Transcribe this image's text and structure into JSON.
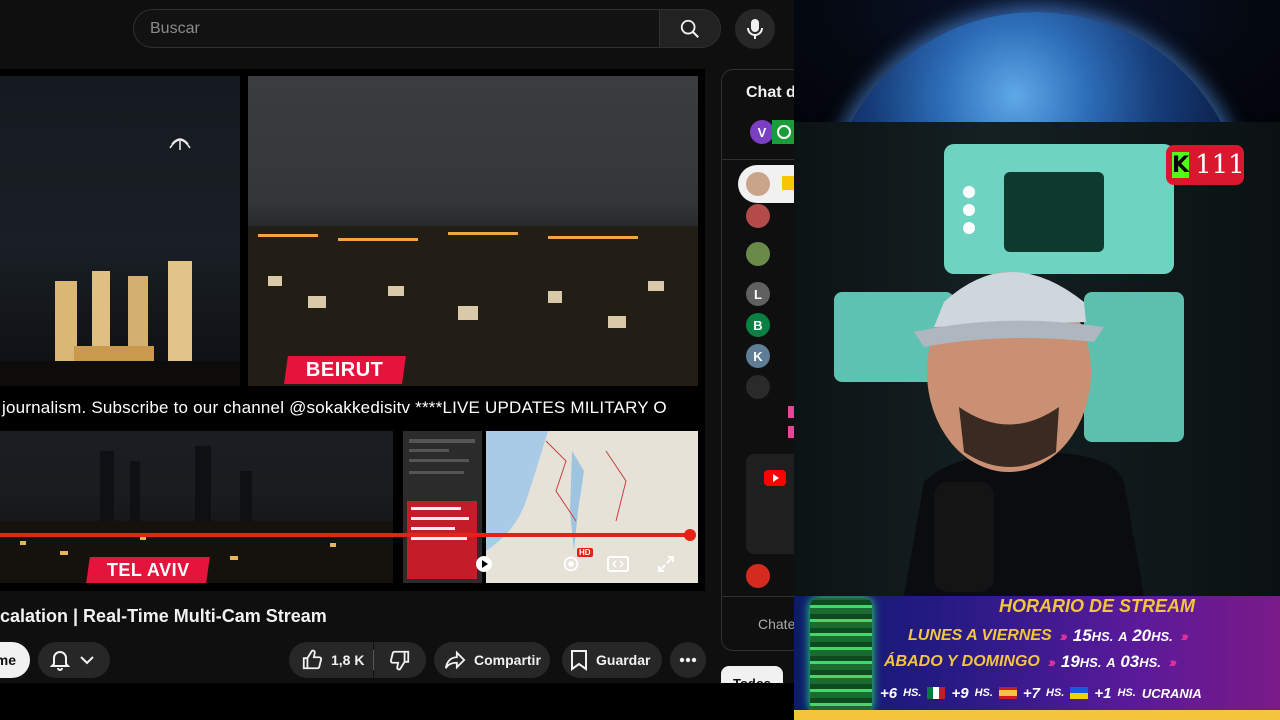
{
  "search": {
    "placeholder": "Buscar"
  },
  "player": {
    "label_beirut": "BEIRUT",
    "label_telaviv": "TEL AVIV",
    "ticker": "journalism. Subscribe to our channel @sokakkedisitv    ****LIVE UPDATES MILITARY O",
    "quality_badge": "HD",
    "progress": 0.99
  },
  "video": {
    "title": "calation | Real-Time Multi-Cam Stream",
    "subscribe_label": "me",
    "like_count": "1,8 K",
    "share_label": "Compartir",
    "save_label": "Guardar"
  },
  "chat": {
    "title": "Chat de",
    "input_placeholder": "Chate",
    "chip_all": "Todos",
    "avatars": [
      {
        "letter": "V",
        "color": "#7b3fc4"
      },
      {
        "letter": "L",
        "color": "#606060"
      },
      {
        "letter": "B",
        "color": "#0b8043"
      },
      {
        "letter": "K",
        "color": "#5f7d95"
      }
    ]
  },
  "overlay": {
    "viewer_count": "111",
    "schedule": {
      "title": "HORARIO DE STREAM",
      "row1_days": "LUNES A VIERNES",
      "row1_from": "15",
      "row1_to": "20",
      "row2_days": "ÁBADO Y DOMINGO",
      "row2_from": "19",
      "row2_to": "03",
      "hs": "HS.",
      "sep": "A",
      "tz": [
        "+6",
        "+9",
        "+7",
        "+1"
      ],
      "tz_last_label": "UCRANIA"
    }
  },
  "colors": {
    "accent_red": "#e62117",
    "city_label": "#e6143c",
    "kick_green": "#53fc18",
    "schedule_gold": "#f3c53c"
  }
}
